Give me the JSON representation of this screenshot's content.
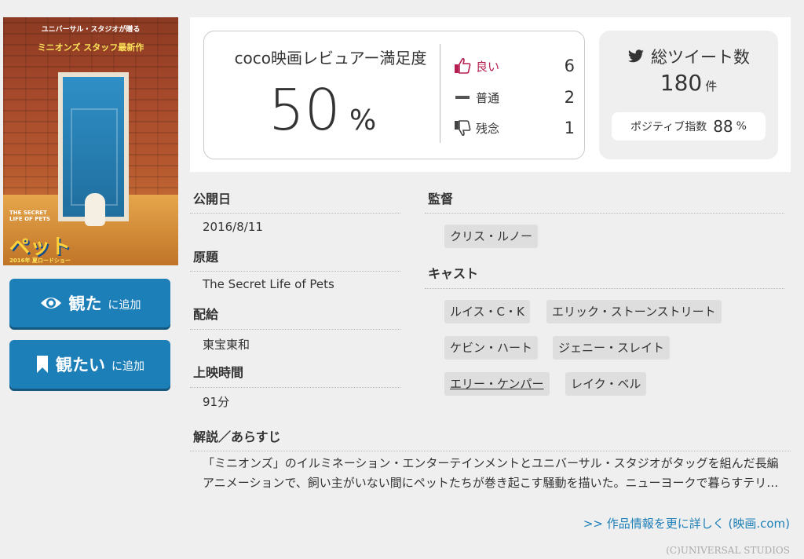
{
  "poster": {
    "top_line": "ユニバーサル・スタジオが贈る",
    "mini_line": "ミニオンズ スタッフ最新作",
    "title_en": "THE SECRET LIFE OF PETS",
    "title_jp": "ペット",
    "date": "2016年 夏ロードショー"
  },
  "buttons": {
    "watched_main": "観た",
    "watched_sub": "に追加",
    "want_main": "観たい",
    "want_sub": "に追加"
  },
  "rating": {
    "title": "coco映画レビュアー満足度",
    "value": "50",
    "percent": "%",
    "votes": [
      {
        "label": "良い",
        "count": "6"
      },
      {
        "label": "普通",
        "count": "2"
      },
      {
        "label": "残念",
        "count": "1"
      }
    ]
  },
  "tweets": {
    "title": "総ツイート数",
    "count": "180",
    "unit": "件",
    "positive_label": "ポジティブ指数",
    "positive_value": "88",
    "positive_unit": "%"
  },
  "info": {
    "release_label": "公開日",
    "release_value": "2016/8/11",
    "original_label": "原題",
    "original_value": "The Secret Life of Pets",
    "distributor_label": "配給",
    "distributor_value": "東宝東和",
    "runtime_label": "上映時間",
    "runtime_value": "91分"
  },
  "director": {
    "label": "監督",
    "names": [
      "クリス・ルノー"
    ]
  },
  "cast": {
    "label": "キャスト",
    "names": [
      "ルイス・C・K",
      "エリック・ストーンストリート",
      "ケビン・ハート",
      "ジェニー・スレイト",
      "エリー・ケンパー",
      "レイク・ベル"
    ]
  },
  "synopsis": {
    "label": "解説／あらすじ",
    "text": "「ミニオンズ」のイルミネーション・エンターテインメントとユニバーサル・スタジオがタッグを組んだ長編アニメーションで、飼い主がいない間にペットたちが巻き起こす騒動を描いた。ニューヨークで暮らすテリ…",
    "more_link": ">> 作品情報を更に詳しく (映画.com)"
  },
  "copyright": "(C)UNIVERSAL STUDIOS",
  "colors": {
    "accent_blue": "#1d7fb8",
    "good_red": "#b51f4f",
    "background": "#efefef"
  }
}
